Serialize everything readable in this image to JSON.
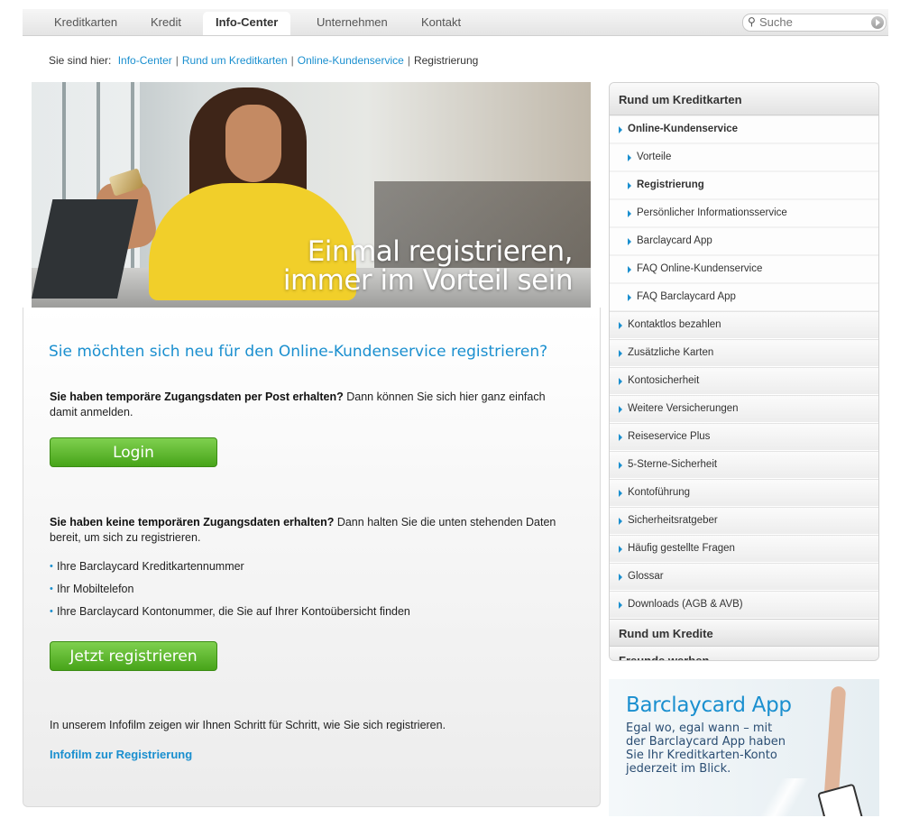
{
  "nav": {
    "tabs": [
      "Kreditkarten",
      "Kredit",
      "Info-Center",
      "Unternehmen",
      "Kontakt"
    ],
    "active_tab": "Info-Center",
    "search_placeholder": "Suche"
  },
  "breadcrumb": {
    "prefix": "Sie sind hier:",
    "items": [
      "Info-Center",
      "Rund um Kreditkarten",
      "Online-Kundenservice"
    ],
    "current": "Registrierung"
  },
  "hero": {
    "headline_line1": "Einmal registrieren,",
    "headline_line2": "immer im Vorteil sein"
  },
  "main": {
    "intro": "Sie möchten sich neu für den Online-Kundenservice registrieren?",
    "p1_bold": "Sie haben temporäre Zugangsdaten per Post erhalten?",
    "p1_text": " Dann können Sie sich hier ganz einfach damit anmelden.",
    "login_button": "Login",
    "p2_bold": "Sie haben keine temporären Zugangsdaten erhalten?",
    "p2_text": " Dann halten Sie die unten stehenden Daten bereit, um sich zu registrieren.",
    "bullets": [
      "Ihre Barclaycard Kreditkartennummer",
      "Ihr Mobiltelefon",
      "Ihre Barclaycard Kontonummer, die Sie auf Ihrer Kontoübersicht finden"
    ],
    "register_button": "Jetzt registrieren",
    "p3": "In unserem Infofilm zeigen wir Ihnen Schritt für Schritt, wie Sie sich registrieren.",
    "infofilm_link": "Infofilm zur Registrierung"
  },
  "sidebar": {
    "header": "Rund um Kreditkarten",
    "section": "Online-Kundenservice",
    "sub_items": [
      "Vorteile",
      "Registrierung",
      "Persönlicher Informationsservice",
      "Barclaycard App",
      "FAQ Online-Kundenservice",
      "FAQ Barclaycard App"
    ],
    "items": [
      "Kontaktlos bezahlen",
      "Zusätzliche Karten",
      "Kontosicherheit",
      "Weitere Versicherungen",
      "Reiseservice Plus",
      "5-Sterne-Sicherheit",
      "Kontoführung",
      "Sicherheitsratgeber",
      "Häufig gestellte Fragen",
      "Glossar",
      "Downloads (AGB & AVB)"
    ],
    "footer1": "Rund um Kredite",
    "footer2": "Freunde werben"
  },
  "promo": {
    "title": "Barclaycard App",
    "text": "Egal wo, egal wann – mit der Barclaycard App haben Sie Ihr Kreditkarten-Konto jederzeit im Blick."
  },
  "colors": {
    "accent": "#1a8fcf",
    "button_green": "#5bb82a"
  }
}
